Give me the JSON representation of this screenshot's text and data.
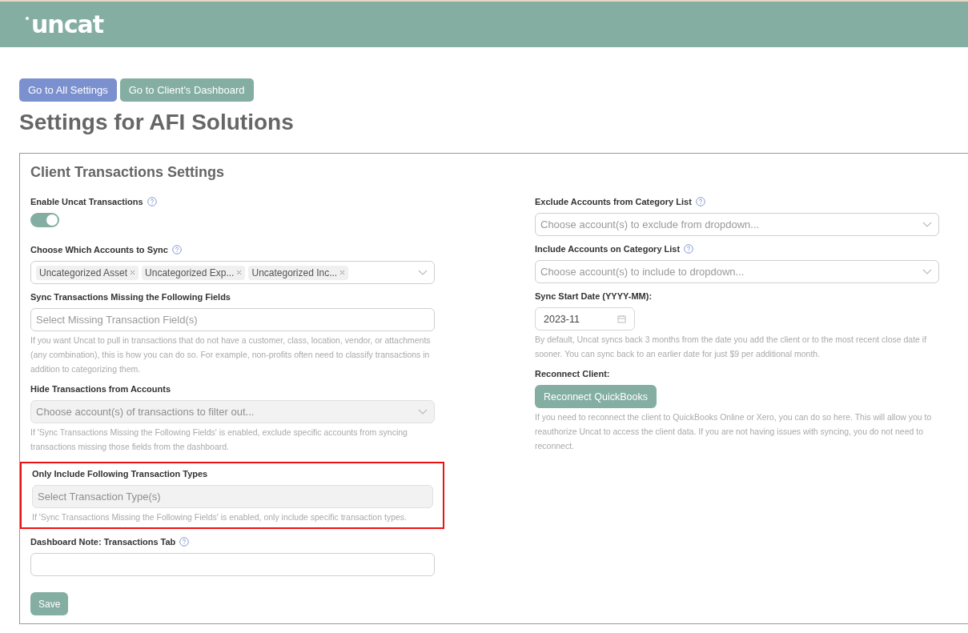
{
  "header": {
    "logo": "uncat"
  },
  "nav_buttons": [
    {
      "label": "Go to All Settings",
      "kind": "primary"
    },
    {
      "label": "Go to Client's Dashboard",
      "kind": "secondary"
    }
  ],
  "page_title": "Settings for AFI Solutions",
  "card": {
    "title": "Client Transactions Settings",
    "left_fields": [
      {
        "kind": "toggle",
        "label": "Enable Uncat Transactions",
        "help": true,
        "on": true
      },
      {
        "kind": "multiselect",
        "label": "Choose Which Accounts to Sync",
        "help": true,
        "tags": [
          "Uncategorized Asset",
          "Uncategorized Exp...",
          "Uncategorized Inc..."
        ]
      },
      {
        "kind": "text",
        "label": "Sync Transactions Missing the Following Fields",
        "help": false,
        "placeholder": "Select Missing Transaction Field(s)",
        "disabled": false,
        "note": "If you want Uncat to pull in transactions that do not have a customer, class, location, vendor, or attachments (any combination), this is how you can do so. For example, non-profits often need to classify transactions in addition to categorizing them."
      },
      {
        "kind": "select",
        "label": "Hide Transactions from Accounts",
        "help": false,
        "placeholder": "Choose account(s) of transactions to filter out...",
        "disabled": true,
        "note": "If 'Sync Transactions Missing the Following Fields' is enabled, exclude specific accounts from syncing transactions missing those fields from the dashboard."
      },
      {
        "kind": "text",
        "label": "Only Include Following Transaction Types",
        "help": false,
        "placeholder": "Select Transaction Type(s)",
        "disabled": true,
        "highlighted": true,
        "note": "If 'Sync Transactions Missing the Following Fields' is enabled, only include specific transaction types."
      },
      {
        "kind": "text",
        "label": "Dashboard Note: Transactions Tab",
        "help": true,
        "disabled": false
      }
    ],
    "right_fields": [
      {
        "kind": "select",
        "label": "Exclude Accounts from Category List",
        "help": true,
        "placeholder": "Choose account(s) to exclude from dropdown...",
        "disabled": false
      },
      {
        "kind": "select",
        "label": "Include Accounts on Category List",
        "help": true,
        "placeholder": "Choose account(s) to include to dropdown...",
        "disabled": false
      },
      {
        "kind": "date",
        "label": "Sync Start Date (YYYY-MM):",
        "help": false,
        "value": "2023-11",
        "note": "By default, Uncat syncs back 3 months from the date you add the client or to the most recent close date if sooner. You can sync back to an earlier date for just $9 per additional month."
      },
      {
        "kind": "button",
        "label": "Reconnect Client:",
        "help": false,
        "button": "Reconnect QuickBooks",
        "note": "If you need to reconnect the client to QuickBooks Online or Xero, you can do so here. This will allow you to reauthorize Uncat to access the client data. If you are not having issues with syncing, you do not need to reconnect."
      }
    ],
    "save_button": "Save"
  }
}
